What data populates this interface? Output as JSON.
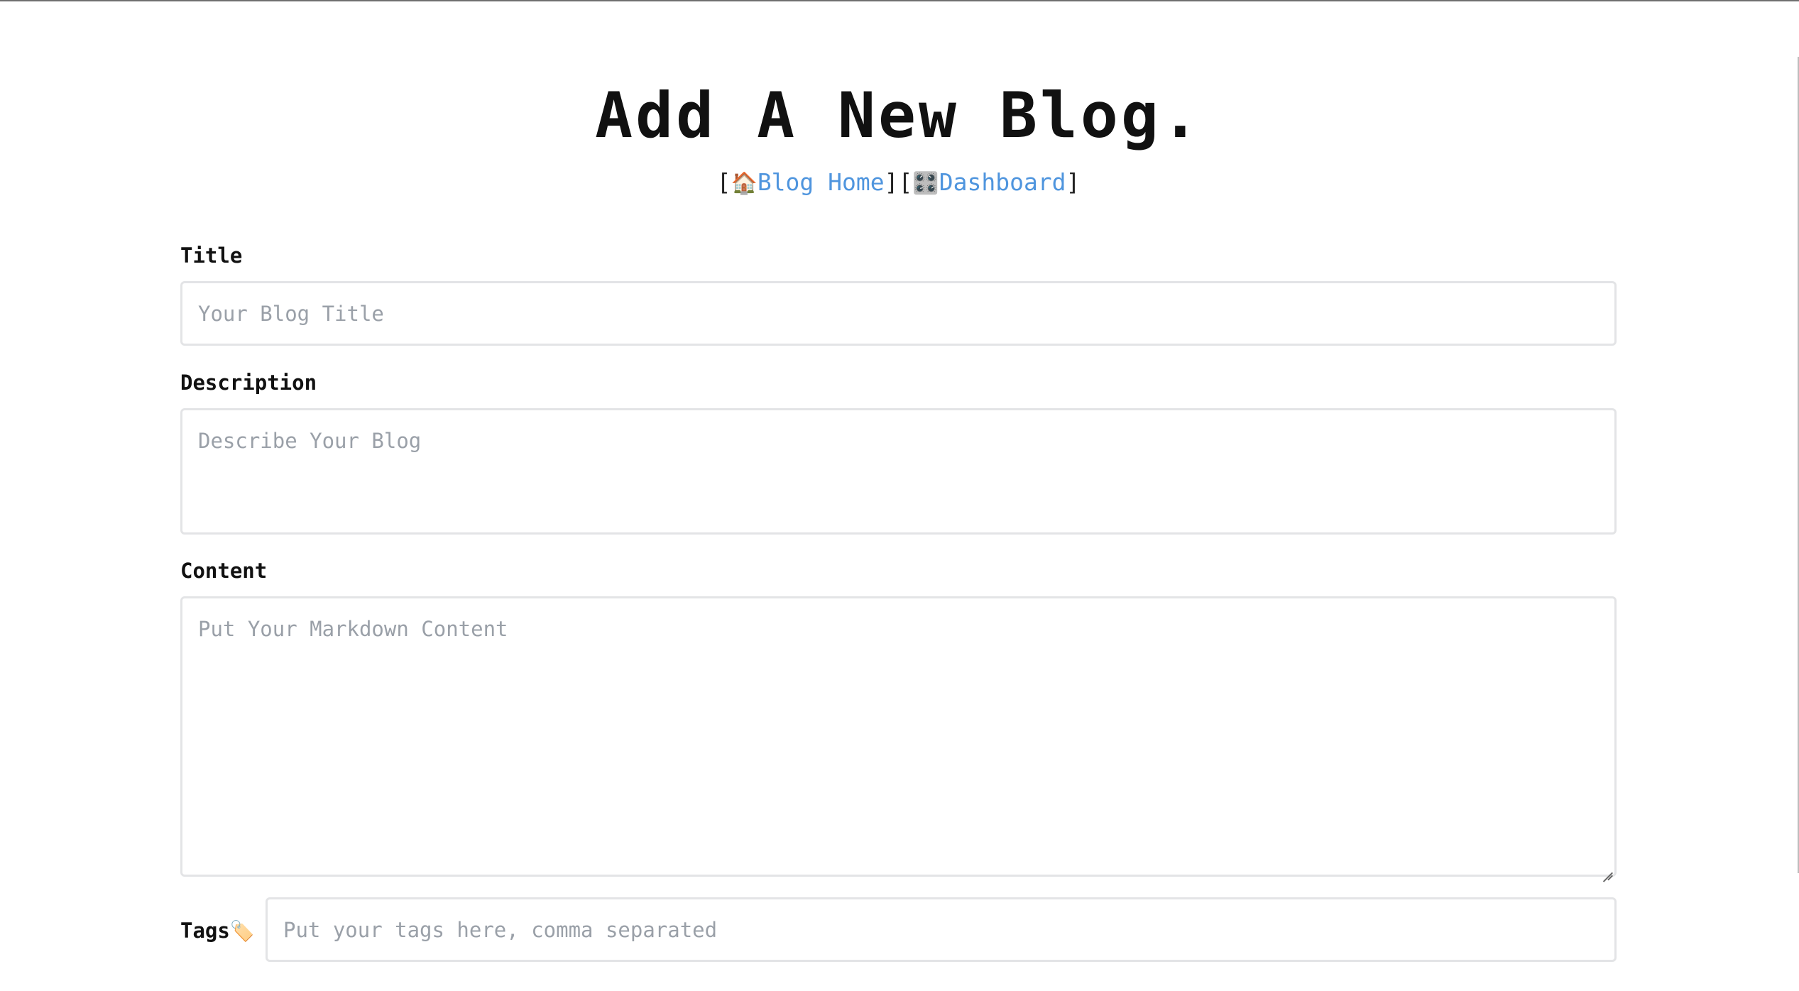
{
  "page": {
    "heading": "Add A New Blog."
  },
  "nav": {
    "open_bracket_1": "[",
    "blog_home_icon": "🏠",
    "blog_home_label": "Blog Home",
    "close_bracket_1": "]",
    "open_bracket_2": "[",
    "dashboard_icon": "🎛️",
    "dashboard_label": "Dashboard",
    "close_bracket_2": "]",
    "link_color": "#4f95de"
  },
  "form": {
    "title": {
      "label": "Title",
      "placeholder": "Your Blog Title",
      "value": ""
    },
    "description": {
      "label": "Description",
      "placeholder": "Describe Your Blog",
      "value": ""
    },
    "content": {
      "label": "Content",
      "placeholder": "Put Your Markdown Content",
      "value": ""
    },
    "tags": {
      "label": "Tags",
      "icon": "🏷️",
      "placeholder": "Put your tags here, comma separated",
      "value": ""
    }
  },
  "colors": {
    "text": "#111111",
    "placeholder": "#9aa0a8",
    "field_border": "#e3e4e6"
  }
}
